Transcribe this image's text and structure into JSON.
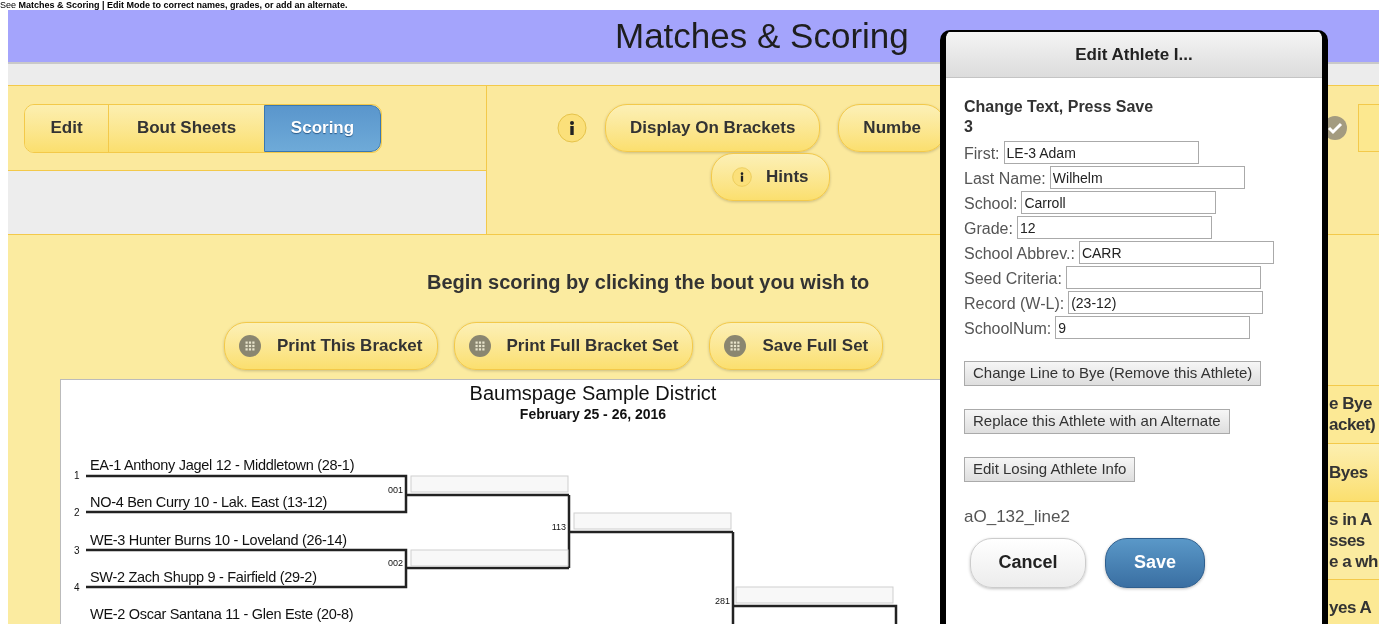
{
  "instruction_banner": "See **Matches & Scoring | Edit Mode to correct names, grades, or add an alternate.**",
  "header": {
    "title": "Matches & Scoring"
  },
  "mode_tabs": [
    {
      "label": "Edit",
      "selected": false
    },
    {
      "label": "Bout Sheets",
      "selected": false
    },
    {
      "label": "Scoring",
      "selected": true
    }
  ],
  "toolbar_row1": [
    {
      "kind": "info"
    },
    {
      "kind": "pill",
      "label": "Display On Brackets"
    },
    {
      "kind": "pill",
      "label": "Numbe"
    },
    {
      "kind": "check"
    }
  ],
  "toolbar_row2": [
    {
      "kind": "info-pill",
      "label": "Hints"
    }
  ],
  "prompt": "Begin scoring by clicking the bout you wish to",
  "print_buttons": [
    "Print This Bracket",
    "Print Full Bracket Set",
    "Save Full Set"
  ],
  "bracket": {
    "title": "Baumspage Sample District",
    "date": "February 25 - 26, 2016",
    "entries": [
      {
        "seed": "1",
        "name": "EA-1 Anthony Jagel 12 - Middletown (28-1)"
      },
      {
        "seed": "2",
        "name": "NO-4 Ben Curry 10 - Lak. East (13-12)"
      },
      {
        "seed": "3",
        "name": "WE-3 Hunter Burns 10 - Loveland (26-14)"
      },
      {
        "seed": "4",
        "name": "SW-2 Zach Shupp 9 - Fairfield (29-2)"
      },
      {
        "name": "WE-2 Oscar Santana 11 - Glen Este (20-8)"
      }
    ],
    "bouts": [
      "001",
      "002",
      "113",
      "281"
    ]
  },
  "side_buttons": [
    {
      "lines": [
        "e Bye",
        "acket)"
      ]
    },
    {
      "lines": [
        "Byes"
      ]
    },
    {
      "lines": [
        "s in A",
        "sses",
        "e a wh"
      ]
    },
    {
      "lines": [
        "yes A"
      ]
    }
  ],
  "dialog": {
    "title": "Edit Athlete I...",
    "heading": "Change Text, Press Save",
    "heading_sub": "3",
    "fields": [
      {
        "label": "First:",
        "value": "LE-3 Adam"
      },
      {
        "label": "Last Name:",
        "value": "Wilhelm"
      },
      {
        "label": "School:",
        "value": "Carroll"
      },
      {
        "label": "Grade:",
        "value": "12"
      },
      {
        "label": "School Abbrev.:",
        "value": "CARR"
      },
      {
        "label": "Seed Criteria:"
      },
      {
        "label": "Record (W-L):",
        "value": "(23-12)"
      },
      {
        "label": "SchoolNum:",
        "value": "9"
      }
    ],
    "actions": [
      "Change Line to Bye (Remove this Athlete)",
      "Replace this Athlete with an Alternate",
      "Edit Losing Athlete Info"
    ],
    "line_id": "aO_132_line2",
    "buttons": [
      {
        "label": "Cancel",
        "kind": "secondary"
      },
      {
        "label": "Save",
        "kind": "primary"
      }
    ]
  }
}
